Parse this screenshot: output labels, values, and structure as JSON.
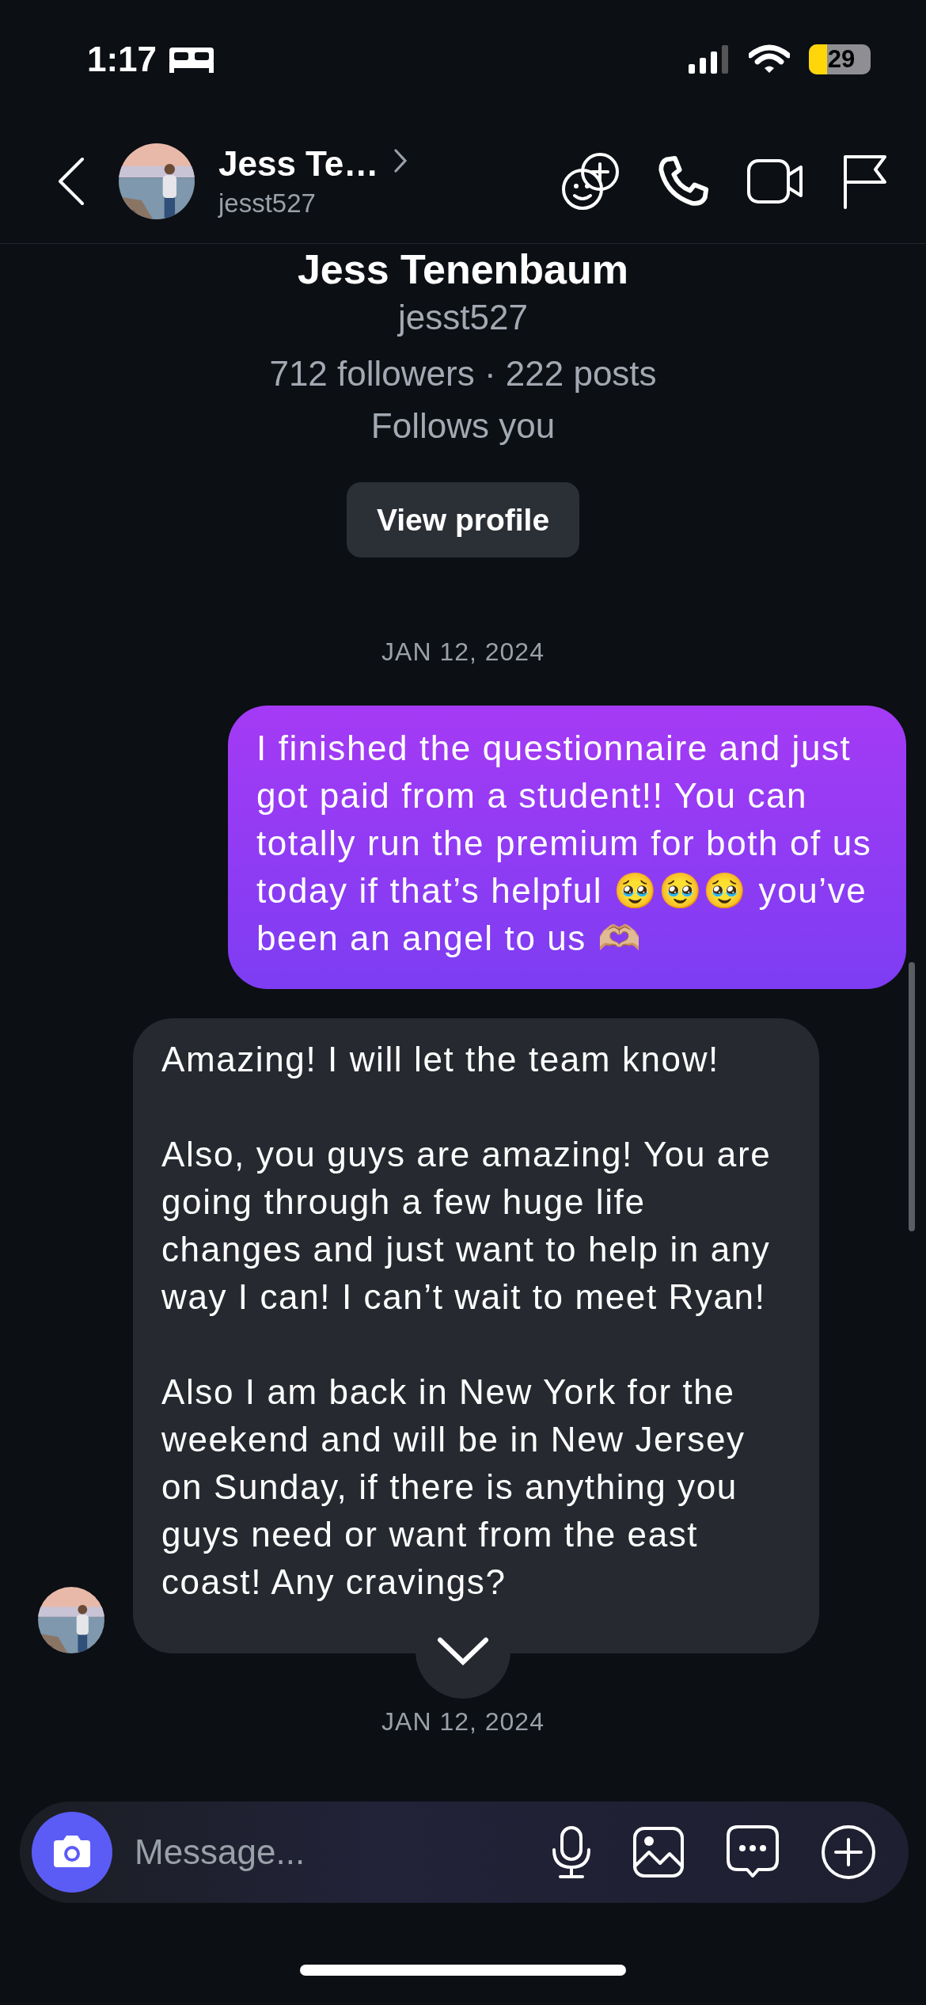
{
  "status_bar": {
    "time": "1:17",
    "battery": "29"
  },
  "header": {
    "name": "Jess Te…",
    "username": "jesst527"
  },
  "profile": {
    "name": "Jess Tenenbaum",
    "username": "jesst527",
    "stats": "712 followers · 222 posts",
    "relation": "Follows you",
    "button": "View profile"
  },
  "messages": [
    {
      "kind": "date",
      "text": "JAN 12, 2024"
    },
    {
      "kind": "sent",
      "text": "I finished the questionnaire and just got paid from a student!! You can totally run the premium for both of us today if that’s helpful 🥹🥹🥹 you’ve been an angel to us 🫶🏼"
    },
    {
      "kind": "received",
      "paragraphs": [
        "Amazing! I will let the team know!",
        "Also, you guys are amazing! You are going through a few huge life changes and just want to help in any way I can! I can’t wait to meet Ryan!",
        "Also I am back in New York for the weekend and will be in New Jersey on Sunday, if there is anything you guys need or want from the east coast! Any cravings?"
      ]
    },
    {
      "kind": "date",
      "text": "JAN 12, 2024"
    }
  ],
  "composer": {
    "placeholder": "Message..."
  }
}
